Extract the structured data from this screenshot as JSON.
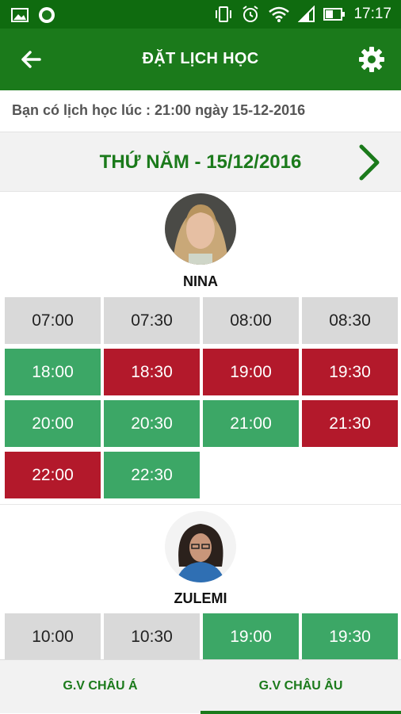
{
  "status_bar": {
    "time": "17:17",
    "icons": [
      "image-icon",
      "app-badge-icon",
      "vibrate-icon",
      "alarm-icon",
      "wifi-icon",
      "signal-icon",
      "battery-icon"
    ]
  },
  "app_bar": {
    "title": "ĐẶT LỊCH HỌC",
    "back_icon": "arrow-left-icon",
    "settings_icon": "gear-icon"
  },
  "notice": "Bạn có lịch học lúc : 21:00 ngày 15-12-2016",
  "date_bar": {
    "label": "THỨ NĂM - 15/12/2016",
    "next_icon": "chevron-right-icon"
  },
  "teachers": [
    {
      "name": "NINA",
      "slots": [
        {
          "time": "07:00",
          "status": "grey"
        },
        {
          "time": "07:30",
          "status": "grey"
        },
        {
          "time": "08:00",
          "status": "grey"
        },
        {
          "time": "08:30",
          "status": "grey"
        },
        {
          "time": "18:00",
          "status": "green"
        },
        {
          "time": "18:30",
          "status": "red"
        },
        {
          "time": "19:00",
          "status": "red"
        },
        {
          "time": "19:30",
          "status": "red"
        },
        {
          "time": "20:00",
          "status": "green"
        },
        {
          "time": "20:30",
          "status": "green"
        },
        {
          "time": "21:00",
          "status": "green"
        },
        {
          "time": "21:30",
          "status": "red"
        },
        {
          "time": "22:00",
          "status": "red"
        },
        {
          "time": "22:30",
          "status": "green"
        }
      ]
    },
    {
      "name": "ZULEMI",
      "slots": [
        {
          "time": "10:00",
          "status": "grey"
        },
        {
          "time": "10:30",
          "status": "grey"
        },
        {
          "time": "19:00",
          "status": "green"
        },
        {
          "time": "19:30",
          "status": "green"
        }
      ]
    }
  ],
  "tabs": [
    {
      "label": "G.V CHÂU Á",
      "active": false
    },
    {
      "label": "G.V CHÂU ÂU",
      "active": true
    }
  ],
  "colors": {
    "primary": "#1b7a1b",
    "status_bar": "#0f6b0f",
    "available": "#3ca766",
    "booked": "#b3192b",
    "disabled": "#d9d9d9"
  }
}
